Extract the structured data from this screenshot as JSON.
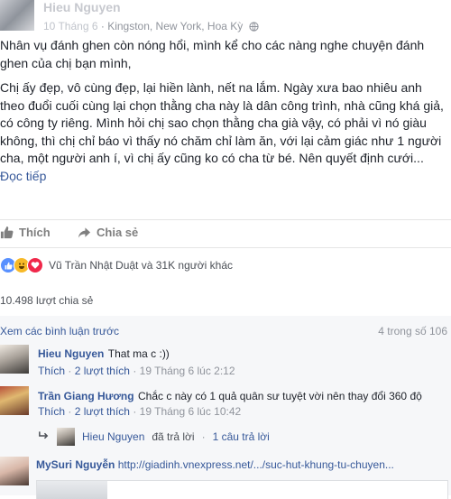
{
  "post": {
    "author": "Hieu Nguyen",
    "date": "10 Tháng 6",
    "location": "Kingston, New York, Hoa Kỳ",
    "paragraph1": "Nhân vụ đánh ghen còn nóng hổi, mình kể cho các nàng nghe chuyện đánh ghen của chị bạn mình,",
    "paragraph2": "Chị ấy đẹp, vô cùng đẹp, lại hiền lành, nết na lắm. Ngày xưa bao nhiêu anh theo đuổi cuối cùng lại chọn thằng cha này là dân công trình, nhà cũng khá giả, có công ty riêng. Mình hỏi chị sao chọn thằng cha già vậy, có phải vì nó giàu không, thì chị chỉ báo vì thấy nó chăm chỉ làm ăn, với lại cảm giác như 1 người cha, một người anh í, vì chị ấy cũng ko có cha từ bé. Nên quyết định cưới...",
    "read_more": "Đọc tiếp"
  },
  "actions": {
    "like_label": "Thích",
    "share_label": "Chia sẻ"
  },
  "reactions": {
    "text": "Vũ Trần Nhật Duật và 31K người khác",
    "types": [
      "like",
      "haha",
      "love"
    ]
  },
  "shares": {
    "text": "10.498 lượt chia sẻ"
  },
  "comments_section": {
    "view_previous": "Xem các bình luận trước",
    "count": "4 trong số 106",
    "comments": [
      {
        "author": "Hieu Nguyen",
        "text": "That ma c :))",
        "like_label": "Thích",
        "likes": "2 lượt thích",
        "time": "19 Tháng 6 lúc 2:12"
      },
      {
        "author": "Trần Giang Hương",
        "text": "Chắc c này có 1 quả quân sư tuyệt vời nên thay đổi 360 độ",
        "like_label": "Thích",
        "likes": "2 lượt thích",
        "time": "19 Tháng 6 lúc 10:42"
      },
      {
        "author": "MySuri Nguyễn",
        "link": "http://giadinh.vnexpress.net/.../suc-hut-khung-tu-chuyen..."
      }
    ],
    "reply": {
      "author": "Hieu Nguyen",
      "action": "đã trả lời",
      "separator": "·",
      "count": "1 câu trả lời"
    }
  },
  "colors": {
    "link": "#365899",
    "meta": "#90949c",
    "like_reaction": "#5890ff",
    "haha_reaction": "#f7b928",
    "love_reaction": "#f0284a"
  }
}
